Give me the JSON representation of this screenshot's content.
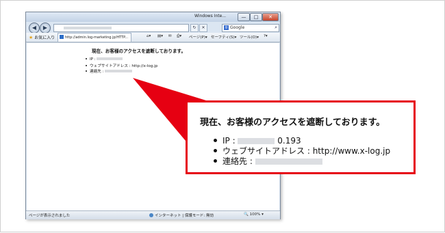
{
  "window": {
    "title": "Windows Inte...",
    "minimize": "—",
    "maximize": "□",
    "close": "✕"
  },
  "address": {
    "refresh": "↻",
    "stop": "✕",
    "search_engine": "Google",
    "search_icon": "⌕"
  },
  "commandbar": {
    "favorites_label": "お気に入り",
    "tab_label": "http://admin.log-marketing.jp/HTTP...",
    "tools": [
      "ページ(P)▾",
      "セーフティ(S)▾",
      "ツール(O)▾",
      "?▾"
    ]
  },
  "page": {
    "title": "現在、お客様のアクセスを遮断しております。",
    "items": [
      {
        "label": "IP :",
        "value": ""
      },
      {
        "label": "ウェブサイトアドレス : ",
        "value": "http://x-log.jp"
      },
      {
        "label": "連絡先 :",
        "value": ""
      }
    ]
  },
  "statusbar": {
    "left": "ページが表示されました",
    "zone": "インターネット | 保護モード: 無効",
    "zoom": "100%"
  },
  "callout": {
    "title": "現在、お客様のアクセスを遮断しております。",
    "ip_label": "IP : ",
    "ip_visible": "0.193",
    "website_label": "ウェブサイトアドレス : ",
    "website_value": "http://www.x-log.jp",
    "contact_label": "連絡先 : "
  },
  "colors": {
    "accent_red": "#e60012"
  }
}
